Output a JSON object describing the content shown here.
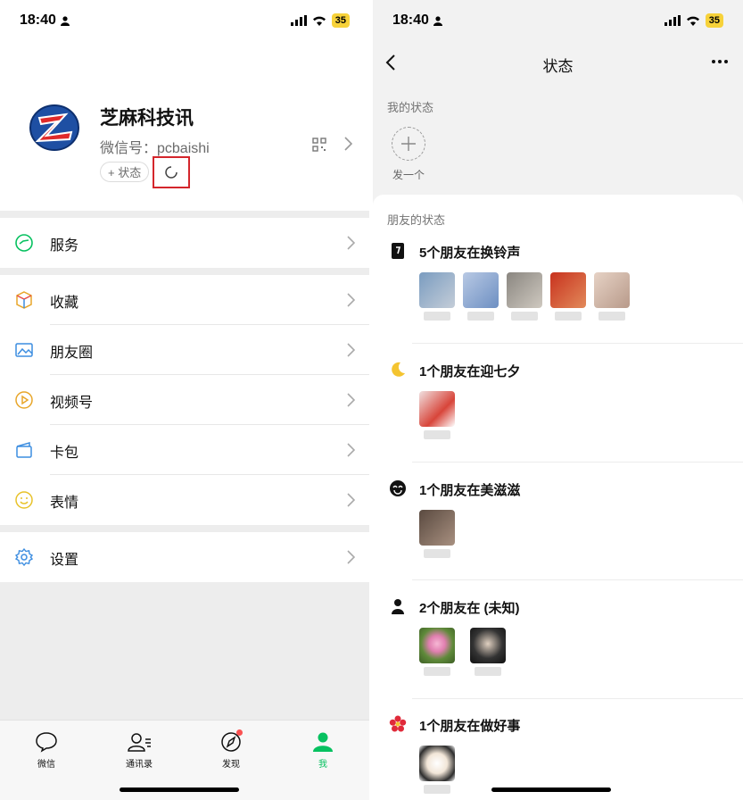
{
  "status_bar": {
    "time": "18:40",
    "battery": "35"
  },
  "profile": {
    "name": "芝麻科技讯",
    "wechat_id": "微信号：pcbaishi",
    "status_button": "+ 状态"
  },
  "menu": {
    "services": "服务",
    "favorites": "收藏",
    "moments": "朋友圈",
    "channels": "视频号",
    "cards": "卡包",
    "stickers": "表情",
    "settings": "设置"
  },
  "tabbar": {
    "chats": "微信",
    "contacts": "通讯录",
    "discover": "发现",
    "me": "我"
  },
  "status_page": {
    "title": "状态",
    "my_status_label": "我的状态",
    "add_label": "发一个",
    "friends_status_label": "朋友的状态",
    "groups": [
      {
        "title": "5个朋友在换铃声",
        "icon": "phone-card-icon",
        "count": 5
      },
      {
        "title": "1个朋友在迎七夕",
        "icon": "moon-icon",
        "count": 1
      },
      {
        "title": "1个朋友在美滋滋",
        "icon": "smile-icon",
        "count": 1
      },
      {
        "title": "2个朋友在 (未知)",
        "icon": "person-icon",
        "count": 2
      },
      {
        "title": "1个朋友在做好事",
        "icon": "flower-icon",
        "count": 1
      }
    ]
  },
  "colors": {
    "accent": "#07c160",
    "highlight_box": "#d4262c",
    "badge": "#fa5151"
  }
}
